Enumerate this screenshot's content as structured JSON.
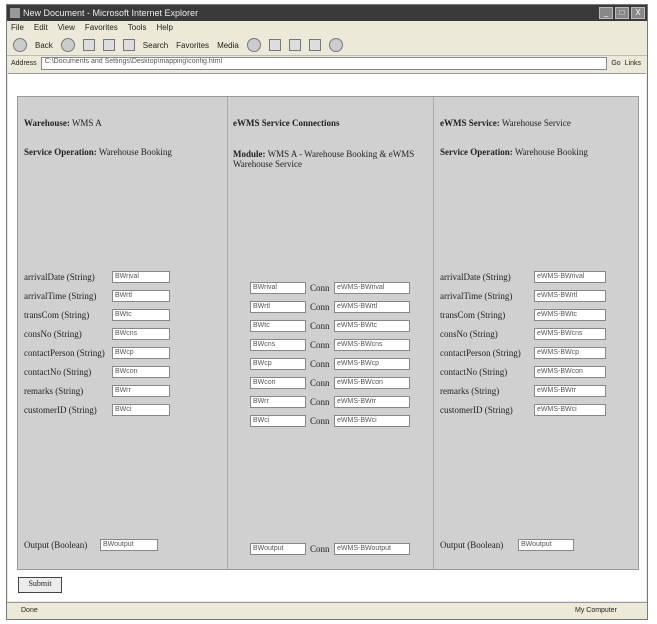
{
  "window": {
    "title": "New Document - Microsoft Internet Explorer",
    "controls": [
      "_",
      "□",
      "X"
    ]
  },
  "menu": [
    "File",
    "Edit",
    "View",
    "Favorites",
    "Tools",
    "Help"
  ],
  "toolbar": {
    "back": "Back",
    "search": "Search",
    "favorites": "Favorites",
    "media": "Media"
  },
  "address": {
    "label": "Address",
    "url": "C:\\Documents and Settings\\Desktop\\mapping\\config.html",
    "go": "Go",
    "links": "Links"
  },
  "col1": {
    "header_label": "Warehouse:",
    "header_value": "WMS A",
    "op_label": "Service Operation:",
    "op_value": "Warehouse Booking",
    "fields": [
      {
        "label": "arrivalDate (String)",
        "value": "BWrival"
      },
      {
        "label": "arrivalTime (String)",
        "value": "BWrtl"
      },
      {
        "label": "transCom (String)",
        "value": "BWtc"
      },
      {
        "label": "consNo (String)",
        "value": "BWcns"
      },
      {
        "label": "contactPerson (String)",
        "value": "BWcp"
      },
      {
        "label": "contactNo (String)",
        "value": "BWcon"
      },
      {
        "label": "remarks (String)",
        "value": "BWrr"
      },
      {
        "label": "customerID (String)",
        "value": "BWci"
      }
    ],
    "output_label": "Output (Boolean)",
    "output_value": "BWoutput"
  },
  "col2": {
    "title": "eWMS Service Connections",
    "module_label": "Module:",
    "module_value": "WMS A - Warehouse Booking & eWMS Warehouse Service",
    "rows": [
      {
        "src": "BWrival",
        "conn": "Conn",
        "dst": "eWMS-BWrival"
      },
      {
        "src": "BWrtl",
        "conn": "Conn",
        "dst": "eWMS-BWrtl"
      },
      {
        "src": "BWtc",
        "conn": "Conn",
        "dst": "eWMS-BWtc"
      },
      {
        "src": "BWcns",
        "conn": "Conn",
        "dst": "eWMS-BWcns"
      },
      {
        "src": "BWcp",
        "conn": "Conn",
        "dst": "eWMS-BWcp"
      },
      {
        "src": "BWcon",
        "conn": "Conn",
        "dst": "eWMS-BWcon"
      },
      {
        "src": "BWrr",
        "conn": "Conn",
        "dst": "eWMS-BWrr"
      },
      {
        "src": "BWci",
        "conn": "Conn",
        "dst": "eWMS-BWci"
      }
    ],
    "output_row": {
      "src": "BWoutput",
      "conn": "Conn",
      "dst": "eWMS-BWoutput"
    }
  },
  "col3": {
    "header_label": "eWMS Service:",
    "header_value": "Warehouse Service",
    "op_label": "Service Operation:",
    "op_value": "Warehouse Booking",
    "fields": [
      {
        "label": "arrivalDate (String)",
        "value": "eWMS-BWrival"
      },
      {
        "label": "arrivalTime (String)",
        "value": "eWMS-BWrtl"
      },
      {
        "label": "transCom (String)",
        "value": "eWMS-BWtc"
      },
      {
        "label": "consNo (String)",
        "value": "eWMS-BWcns"
      },
      {
        "label": "contactPerson (String)",
        "value": "eWMS-BWcp"
      },
      {
        "label": "contactNo (String)",
        "value": "eWMS-BWcon"
      },
      {
        "label": "remarks (String)",
        "value": "eWMS-BWrr"
      },
      {
        "label": "customerID (String)",
        "value": "eWMS-BWci"
      }
    ],
    "output_label": "Output (Boolean)",
    "output_value": "BWoutput"
  },
  "submit_label": "Submit",
  "status": {
    "left": "Done",
    "zone": "My Computer"
  }
}
